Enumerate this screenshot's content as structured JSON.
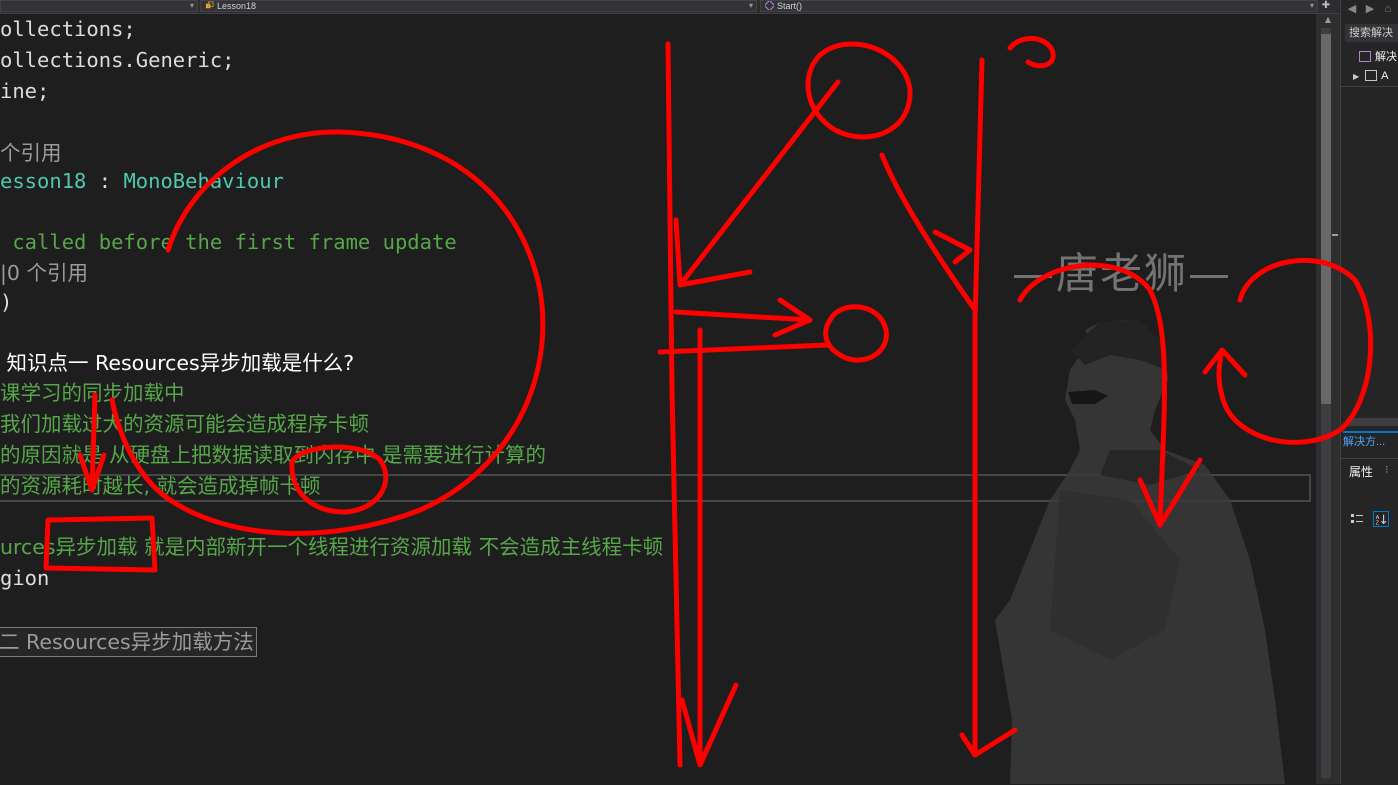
{
  "navbar": {
    "project_dropdown": "",
    "class_dropdown": "Lesson18",
    "member_dropdown": "Start()",
    "dropdown_chevron": "▾",
    "pin_icon": "pin-icon"
  },
  "code": {
    "line1": "ollections;",
    "line2": "ollections.Generic;",
    "line3": "ine;",
    "line5": "个引用",
    "line6_name": "esson18",
    "line6_sep": " : ",
    "line6_base": "MonoBehaviour",
    "line8": " called before the first frame update",
    "line9": "|0 个引用",
    "line10": ")",
    "line12": " 知识点一 Resources异步加载是什么?",
    "line13": "课学习的同步加载中",
    "line14": "我们加载过大的资源可能会造成程序卡顿",
    "line15": "的原因就是 从硬盘上把数据读取到内存中 是需要进行计算的",
    "line16": "的资源耗时越长, 就会造成掉帧卡顿",
    "line18": "urces异步加载 就是内部新开一个线程进行资源加载 不会造成主线程卡顿",
    "line19": "gion",
    "line21": "二 Resources异步加载方法"
  },
  "side_panel": {
    "search_placeholder": "搜索解决",
    "tree_item_1": "解决",
    "tree_item_2": "A",
    "tab_label": "解决方...",
    "properties_title": "属性",
    "properties_pin": "⁝",
    "back_icon": "back-icon",
    "forward_icon": "forward-icon",
    "home_icon": "home-icon"
  },
  "watermark": "—唐老狮—",
  "colors": {
    "background": "#1e1e1e",
    "keyword_teal": "#4ec9b0",
    "comment_green": "#57a64a",
    "reference_gray": "#9b9b9b",
    "annotation_red": "#ff0000"
  }
}
